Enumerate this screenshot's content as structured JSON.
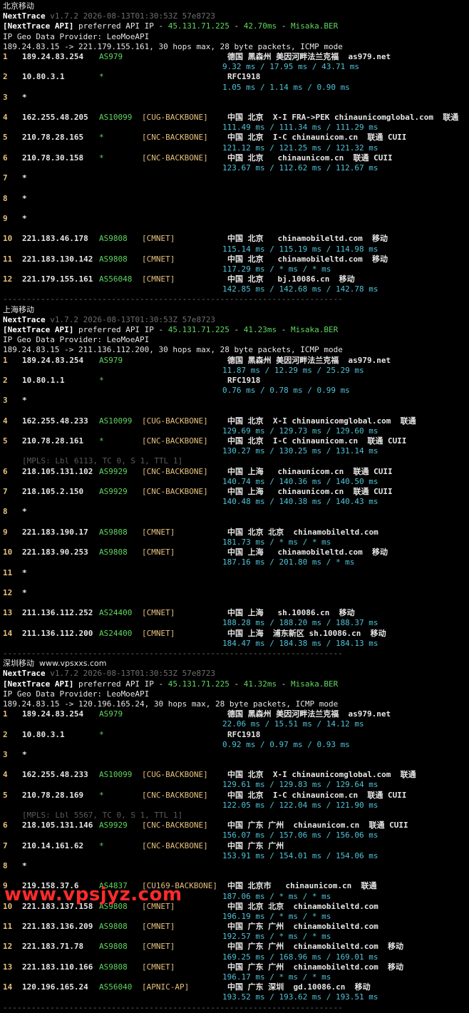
{
  "sections": [
    {
      "title": "北京移动",
      "tool_version": "NextTrace v1.7.2 2026-08-13T01:30:53Z 57e8723",
      "api_line": {
        "prefix": "[NextTrace API]",
        "text": " preferred API IP - ",
        "ip": "45.131.71.225",
        "latency": "42.70ms",
        "node": "Misaka.BER"
      },
      "geo_provider": "IP Geo Data Provider: LeoMoeAPI",
      "trace_header": "189.24.83.15 -> 221.179.155.161, 30 hops max, 28 byte packets, ICMP mode",
      "hops": [
        {
          "no": "1",
          "ip": "189.24.83.254",
          "as": "AS979",
          "tag": "",
          "geo": "德国 黑森州 美因河畔法兰克福  as979.net",
          "rtt": "9.32 ms / 17.95 ms / 43.71 ms"
        },
        {
          "no": "2",
          "ip": "10.80.3.1",
          "as": "*",
          "tag": "",
          "geo": "RFC1918",
          "rtt": "1.05 ms / 1.14 ms / 0.90 ms"
        },
        {
          "no": "3",
          "ip": "*",
          "as": "",
          "tag": "",
          "geo": "",
          "rtt": ""
        },
        {
          "no": "4",
          "ip": "162.255.48.205",
          "as": "AS10099",
          "tag": "[CUG-BACKBONE]",
          "geo": "中国 北京  X-I FRA->PEK chinaunicomglobal.com  联通",
          "rtt": "111.49 ms / 111.34 ms / 111.29 ms"
        },
        {
          "no": "5",
          "ip": "210.78.28.165",
          "as": "*",
          "tag": "[CNC-BACKBONE]",
          "geo": "中国 北京  I-C chinaunicom.cn  联通 CUII",
          "rtt": "121.12 ms / 121.25 ms / 121.32 ms"
        },
        {
          "no": "6",
          "ip": "210.78.30.158",
          "as": "*",
          "tag": "[CNC-BACKBONE]",
          "geo": "中国 北京   chinaunicom.cn  联通 CUII",
          "rtt": "123.67 ms / 112.62 ms / 112.67 ms"
        },
        {
          "no": "7",
          "ip": "*",
          "as": "",
          "tag": "",
          "geo": "",
          "rtt": ""
        },
        {
          "no": "8",
          "ip": "*",
          "as": "",
          "tag": "",
          "geo": "",
          "rtt": ""
        },
        {
          "no": "9",
          "ip": "*",
          "as": "",
          "tag": "",
          "geo": "",
          "rtt": ""
        },
        {
          "no": "10",
          "ip": "221.183.46.178",
          "as": "AS9808",
          "tag": "[CMNET]",
          "geo": "中国 北京   chinamobileltd.com  移动",
          "rtt": "115.14 ms / 115.19 ms / 114.98 ms"
        },
        {
          "no": "11",
          "ip": "221.183.130.142",
          "as": "AS9808",
          "tag": "[CMNET]",
          "geo": "中国 北京   chinamobileltd.com  移动",
          "rtt": "117.29 ms / * ms / * ms"
        },
        {
          "no": "12",
          "ip": "221.179.155.161",
          "as": "AS56048",
          "tag": "[CMNET]",
          "geo": "中国 北京   bj.10086.cn  移动",
          "rtt": "142.85 ms / 142.68 ms / 142.78 ms"
        }
      ]
    },
    {
      "title": "上海移动",
      "tool_version": "NextTrace v1.7.2 2026-08-13T01:30:53Z 57e8723",
      "api_line": {
        "prefix": "[NextTrace API]",
        "text": " preferred API IP - ",
        "ip": "45.131.71.225",
        "latency": "41.23ms",
        "node": "Misaka.BER"
      },
      "geo_provider": "IP Geo Data Provider: LeoMoeAPI",
      "trace_header": "189.24.83.15 -> 211.136.112.200, 30 hops max, 28 byte packets, ICMP mode",
      "hops": [
        {
          "no": "1",
          "ip": "189.24.83.254",
          "as": "AS979",
          "tag": "",
          "geo": "德国 黑森州 美因河畔法兰克福  as979.net",
          "rtt": "11.87 ms / 12.29 ms / 25.29 ms"
        },
        {
          "no": "2",
          "ip": "10.80.1.1",
          "as": "*",
          "tag": "",
          "geo": "RFC1918",
          "rtt": "0.76 ms / 0.78 ms / 0.99 ms"
        },
        {
          "no": "3",
          "ip": "*",
          "as": "",
          "tag": "",
          "geo": "",
          "rtt": ""
        },
        {
          "no": "4",
          "ip": "162.255.48.233",
          "as": "AS10099",
          "tag": "[CUG-BACKBONE]",
          "geo": "中国 北京  X-I chinaunicomglobal.com  联通",
          "rtt": "129.69 ms / 129.73 ms / 129.60 ms"
        },
        {
          "no": "5",
          "ip": "210.78.28.161",
          "as": "*",
          "tag": "[CNC-BACKBONE]",
          "geo": "中国 北京  I-C chinaunicom.cn  联通 CUII",
          "rtt": "130.27 ms / 130.25 ms / 131.14 ms"
        },
        {
          "no": "6",
          "ip": "218.105.131.102",
          "as": "AS9929",
          "tag": "[CNC-BACKBONE]",
          "geo": "中国 上海   chinaunicom.cn  联通 CUII",
          "rtt": "140.74 ms / 140.36 ms / 140.50 ms",
          "mpls": "[MPLS: Lbl 6113, TC 0, S 1, TTL 1]"
        },
        {
          "no": "7",
          "ip": "218.105.2.150",
          "as": "AS9929",
          "tag": "[CNC-BACKBONE]",
          "geo": "中国 上海   chinaunicom.cn  联通 CUII",
          "rtt": "140.48 ms / 140.38 ms / 140.43 ms"
        },
        {
          "no": "8",
          "ip": "*",
          "as": "",
          "tag": "",
          "geo": "",
          "rtt": ""
        },
        {
          "no": "9",
          "ip": "221.183.190.17",
          "as": "AS9808",
          "tag": "[CMNET]",
          "geo": "中国 北京 北京  chinamobileltd.com",
          "rtt": "181.73 ms / * ms / * ms"
        },
        {
          "no": "10",
          "ip": "221.183.90.253",
          "as": "AS9808",
          "tag": "[CMNET]",
          "geo": "中国 上海   chinamobileltd.com  移动",
          "rtt": "187.16 ms / 201.80 ms / * ms"
        },
        {
          "no": "11",
          "ip": "*",
          "as": "",
          "tag": "",
          "geo": "",
          "rtt": ""
        },
        {
          "no": "12",
          "ip": "*",
          "as": "",
          "tag": "",
          "geo": "",
          "rtt": ""
        },
        {
          "no": "13",
          "ip": "211.136.112.252",
          "as": "AS24400",
          "tag": "[CMNET]",
          "geo": "中国 上海   sh.10086.cn  移动",
          "rtt": "188.28 ms / 188.20 ms / 188.37 ms"
        },
        {
          "no": "14",
          "ip": "211.136.112.200",
          "as": "AS24400",
          "tag": "[CMNET]",
          "geo": "中国 上海  浦东新区 sh.10086.cn  移动",
          "rtt": "184.47 ms / 184.38 ms / 184.13 ms"
        }
      ]
    },
    {
      "title": "深圳移动  www.vpsxxs.com",
      "tool_version": "NextTrace v1.7.2 2026-08-13T01:30:53Z 57e8723",
      "api_line": {
        "prefix": "[NextTrace API]",
        "text": " preferred API IP - ",
        "ip": "45.131.71.225",
        "latency": "41.32ms",
        "node": "Misaka.BER"
      },
      "geo_provider": "IP Geo Data Provider: LeoMoeAPI",
      "trace_header": "189.24.83.15 -> 120.196.165.24, 30 hops max, 28 byte packets, ICMP mode",
      "hops": [
        {
          "no": "1",
          "ip": "189.24.83.254",
          "as": "AS979",
          "tag": "",
          "geo": "德国 黑森州 美因河畔法兰克福  as979.net",
          "rtt": "22.06 ms / 15.51 ms / 14.12 ms"
        },
        {
          "no": "2",
          "ip": "10.80.3.1",
          "as": "*",
          "tag": "",
          "geo": "RFC1918",
          "rtt": "0.92 ms / 0.97 ms / 0.93 ms"
        },
        {
          "no": "3",
          "ip": "*",
          "as": "",
          "tag": "",
          "geo": "",
          "rtt": ""
        },
        {
          "no": "4",
          "ip": "162.255.48.233",
          "as": "AS10099",
          "tag": "[CUG-BACKBONE]",
          "geo": "中国 北京  X-I chinaunicomglobal.com  联通",
          "rtt": "129.61 ms / 129.83 ms / 129.64 ms"
        },
        {
          "no": "5",
          "ip": "210.78.28.169",
          "as": "*",
          "tag": "[CNC-BACKBONE]",
          "geo": "中国 北京  I-C chinaunicom.cn  联通 CUII",
          "rtt": "122.05 ms / 122.04 ms / 121.90 ms"
        },
        {
          "no": "6",
          "ip": "218.105.131.146",
          "as": "AS9929",
          "tag": "[CNC-BACKBONE]",
          "geo": "中国 广东 广州  chinaunicom.cn  联通 CUII",
          "rtt": "156.07 ms / 157.06 ms / 156.06 ms",
          "mpls": "[MPLS: Lbl 5567, TC 0, S 1, TTL 1]"
        },
        {
          "no": "7",
          "ip": "210.14.161.62",
          "as": "*",
          "tag": "[CNC-BACKBONE]",
          "geo": "中国 广东 广州",
          "rtt": "153.91 ms / 154.01 ms / 154.06 ms"
        },
        {
          "no": "8",
          "ip": "*",
          "as": "",
          "tag": "",
          "geo": "",
          "rtt": ""
        },
        {
          "no": "9",
          "ip": "219.158.37.6",
          "as": "AS4837",
          "tag": "[CU169-BACKBONE]",
          "geo": "中国 北京市   chinaunicom.cn  联通",
          "rtt": "187.06 ms / * ms / * ms"
        },
        {
          "no": "10",
          "ip": "221.183.137.158",
          "as": "AS9808",
          "tag": "[CMNET]",
          "geo": "中国 北京 北京  chinamobileltd.com",
          "rtt": "196.19 ms / * ms / * ms"
        },
        {
          "no": "11",
          "ip": "221.183.136.209",
          "as": "AS9808",
          "tag": "[CMNET]",
          "geo": "中国 广东 广州  chinamobileltd.com",
          "rtt": "192.57 ms / * ms / * ms"
        },
        {
          "no": "12",
          "ip": "221.183.71.78",
          "as": "AS9808",
          "tag": "[CMNET]",
          "geo": "中国 广东 广州  chinamobileltd.com  移动",
          "rtt": "169.25 ms / 168.96 ms / 169.01 ms"
        },
        {
          "no": "13",
          "ip": "221.183.110.166",
          "as": "AS9808",
          "tag": "[CMNET]",
          "geo": "中国 广东 广州  chinamobileltd.com  移动",
          "rtt": "196.17 ms / * ms / * ms"
        },
        {
          "no": "14",
          "ip": "120.196.165.24",
          "as": "AS56040",
          "tag": "[APNIC-AP]",
          "geo": "中国 广东 深圳  gd.10086.cn  移动",
          "rtt": "193.52 ms / 193.62 ms / 193.51 ms"
        }
      ]
    }
  ],
  "separator": "------------------------------------------------------------------------",
  "watermark": "www.vpsjyz.com"
}
